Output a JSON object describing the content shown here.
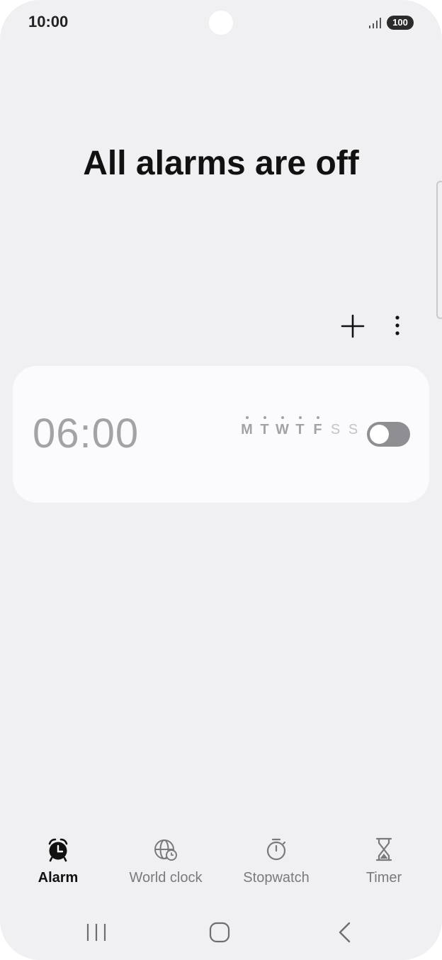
{
  "status_bar": {
    "time": "10:00",
    "battery": "100"
  },
  "header": {
    "title": "All alarms are off"
  },
  "toolbar": {
    "add_icon": "plus-icon",
    "more_icon": "more-vertical-icon"
  },
  "alarm": {
    "time": "06:00",
    "enabled": false,
    "days": [
      {
        "letter": "M",
        "active": true
      },
      {
        "letter": "T",
        "active": true
      },
      {
        "letter": "W",
        "active": true
      },
      {
        "letter": "T",
        "active": true
      },
      {
        "letter": "F",
        "active": true
      },
      {
        "letter": "S",
        "active": false
      },
      {
        "letter": "S",
        "active": false
      }
    ]
  },
  "tabs": [
    {
      "label": "Alarm",
      "icon": "alarm-clock-icon",
      "active": true
    },
    {
      "label": "World clock",
      "icon": "globe-clock-icon",
      "active": false
    },
    {
      "label": "Stopwatch",
      "icon": "stopwatch-icon",
      "active": false
    },
    {
      "label": "Timer",
      "icon": "hourglass-icon",
      "active": false
    }
  ],
  "nav_bar": {
    "recents_icon": "recents-icon",
    "home_icon": "home-icon",
    "back_icon": "back-icon"
  },
  "colors": {
    "background": "#f0f0f3",
    "card": "#fbfbfd",
    "muted_text": "#a3a3a6",
    "toggle_off": "#8f8f93"
  }
}
